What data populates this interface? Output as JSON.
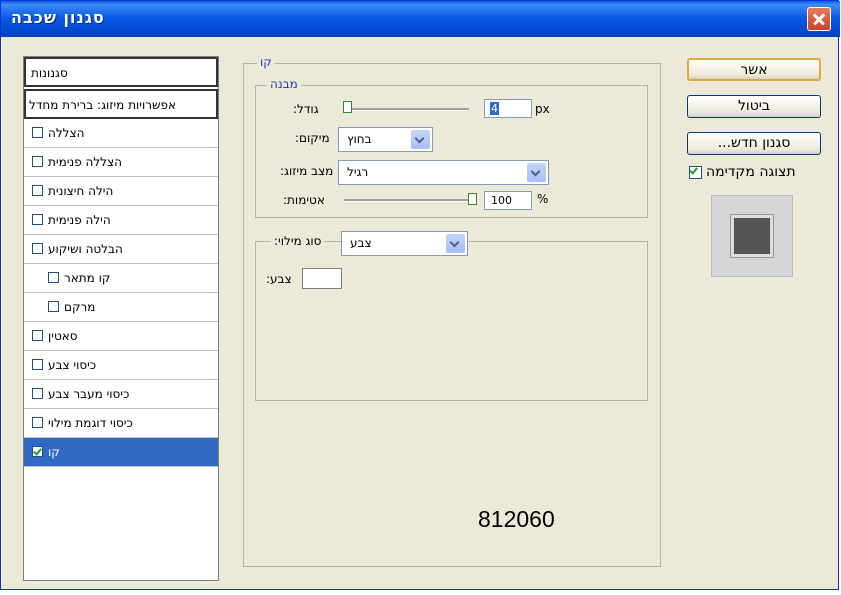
{
  "window": {
    "title": "סגנון שכבה"
  },
  "styles_list": {
    "header": "סגנונות",
    "blend_options": "אפשרויות מיזוג: ברירת מחדל",
    "items": [
      {
        "label": "הצללה",
        "checked": false
      },
      {
        "label": "הצללה פנימית",
        "checked": false
      },
      {
        "label": "הילה חיצונית",
        "checked": false
      },
      {
        "label": "הילה פנימית",
        "checked": false
      },
      {
        "label": "הבלטה ושיקוע",
        "checked": false
      },
      {
        "label": "קו מתאר",
        "checked": false
      },
      {
        "label": "מרקם",
        "checked": false
      },
      {
        "label": "סאטין",
        "checked": false
      },
      {
        "label": "כיסוי צבע",
        "checked": false
      },
      {
        "label": "כיסוי מעבר צבע",
        "checked": false
      },
      {
        "label": "כיסוי דוגמת מילוי",
        "checked": false
      },
      {
        "label": "קו",
        "checked": true
      }
    ]
  },
  "stroke": {
    "group_title": "קו",
    "structure_title": "מבנה",
    "size_label": ":גודל",
    "size_value": "4",
    "size_unit": "px",
    "position_label": ":מיקום",
    "position_value": "בחוץ",
    "blend_label": ":מצב מיזוג",
    "blend_value": "רגיל",
    "opacity_label": ":אטימות",
    "opacity_value": "100",
    "opacity_unit": "%",
    "fill_type_label": ":סוג מילוי",
    "fill_type_value": "צבע",
    "color_label": ":צבע"
  },
  "buttons": {
    "ok": "אשר",
    "cancel": "ביטול",
    "new_style": "...סגנון חדש"
  },
  "preview": {
    "label": "תצוגה מקדימה",
    "checked": true
  },
  "overlay_number": "812060",
  "colors": {
    "title_bar": "#0a5ae5",
    "selection": "#316ac5",
    "preview_square": "#555555",
    "dialog_bg": "#ece9d8"
  }
}
